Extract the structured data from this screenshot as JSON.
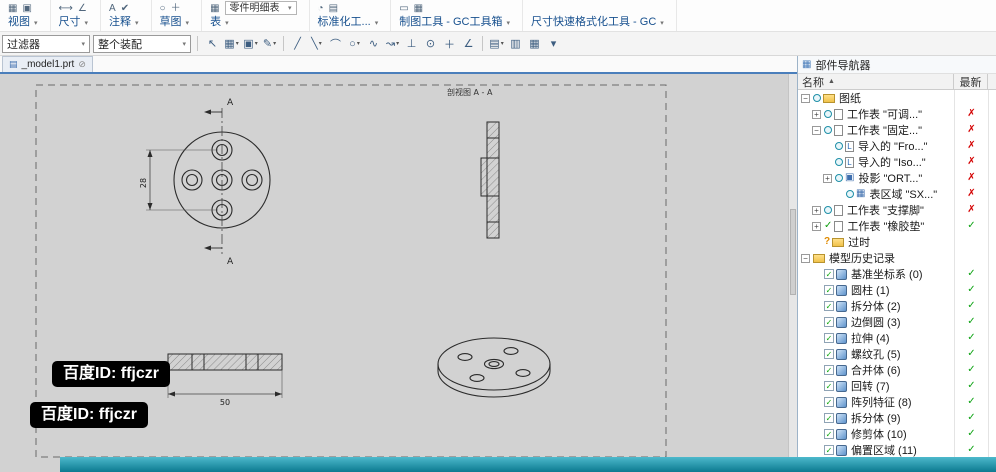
{
  "colors": {
    "accent_blue": "#4a7ebb",
    "status_red": "#d40000",
    "status_green": "#0da313",
    "canvas_bg": "#d2d2d2",
    "bottom_bar_top": "#4db9cc",
    "bottom_bar_bottom": "#0c7a90"
  },
  "ribbon": {
    "groups": [
      {
        "label": "视图",
        "icons": [
          "▦",
          "▣"
        ]
      },
      {
        "label": "尺寸",
        "icons": [
          "⟷",
          "∠"
        ]
      },
      {
        "label": "注释",
        "icons": [
          "A",
          "✔"
        ]
      },
      {
        "label": "草图",
        "icons": [
          "○",
          "＋"
        ]
      },
      {
        "label": "表",
        "icons": [
          "▦"
        ],
        "combo": "零件明细表"
      },
      {
        "label": "标准化工...",
        "icons": [
          "◔",
          "▤"
        ]
      },
      {
        "label": "制图工具 - GC工具箱",
        "icons": [
          "▭",
          "▦"
        ]
      },
      {
        "label": "尺寸快速格式化工具 - GC",
        "icons": []
      }
    ]
  },
  "toolbar": {
    "filter_label": "过滤器",
    "assembly_label": "整个装配",
    "icons": [
      {
        "g": "↖",
        "name": "select-cursor"
      },
      {
        "g": "▦",
        "dd": true,
        "name": "snap-grid"
      },
      {
        "g": "▣",
        "dd": true,
        "name": "display-style"
      },
      {
        "g": "✎",
        "dd": true,
        "name": "edit-sketch"
      },
      {
        "g": "sep"
      },
      {
        "g": "╱",
        "name": "line-tool"
      },
      {
        "g": "╲",
        "dd": true,
        "name": "profile-tool"
      },
      {
        "g": "⌒",
        "name": "arc-tool"
      },
      {
        "g": "○",
        "dd": true,
        "name": "circle-tool"
      },
      {
        "g": "∿",
        "name": "spline-tool"
      },
      {
        "g": "↝",
        "dd": true,
        "name": "studio-spline-tool"
      },
      {
        "g": "⊥",
        "name": "perpendicular-tool"
      },
      {
        "g": "⊙",
        "name": "point-tool"
      },
      {
        "g": "＋",
        "name": "plus-tool"
      },
      {
        "g": "∠",
        "name": "angle-tool"
      },
      {
        "g": "sep"
      },
      {
        "g": "▤",
        "dd": true,
        "name": "sheet-layout"
      },
      {
        "g": "▥",
        "name": "view-window"
      },
      {
        "g": "▦",
        "name": "grid-display"
      },
      {
        "g": "▾",
        "name": "more-options"
      }
    ]
  },
  "tab": {
    "label": "_model1.prt"
  },
  "canvas": {
    "section_view_label": "剖视图 A - A",
    "section_letter": "A",
    "dim_vertical": "28",
    "dim_horizontal": "50",
    "watermark": "百度ID: ffjczr"
  },
  "navigator": {
    "title": "部件导航器",
    "columns": [
      "名称",
      "最新"
    ],
    "rows": [
      {
        "indent": 0,
        "expand": "-",
        "marks": [
          "clock",
          "folder"
        ],
        "label": "图纸",
        "status": ""
      },
      {
        "indent": 1,
        "expand": "+",
        "marks": [
          "clock",
          "sheet"
        ],
        "label": "工作表 \"可调...\"",
        "status": "x"
      },
      {
        "indent": 1,
        "expand": "-",
        "marks": [
          "clock",
          "sheet"
        ],
        "label": "工作表 \"固定...\"",
        "status": "x"
      },
      {
        "indent": 2,
        "expand": "",
        "marks": [
          "clock",
          "import"
        ],
        "label": "导入的 \"Fro...\"",
        "status": "x"
      },
      {
        "indent": 2,
        "expand": "",
        "marks": [
          "clock",
          "import"
        ],
        "label": "导入的 \"Iso...\"",
        "status": "x"
      },
      {
        "indent": 2,
        "expand": "+",
        "marks": [
          "clock",
          "proj"
        ],
        "label": "投影 \"ORT...\"",
        "status": "x"
      },
      {
        "indent": 3,
        "expand": "",
        "marks": [
          "clock",
          "table"
        ],
        "label": "表区域 \"SX...\"",
        "status": "x"
      },
      {
        "indent": 1,
        "expand": "+",
        "marks": [
          "clock",
          "sheet"
        ],
        "label": "工作表 \"支撑脚\"",
        "status": "x"
      },
      {
        "indent": 1,
        "expand": "+",
        "marks": [
          "check",
          "sheet"
        ],
        "label": "工作表 \"橡胶垫\"",
        "status": "check"
      },
      {
        "indent": 1,
        "expand": "",
        "marks": [
          "question",
          "folder"
        ],
        "label": "过时",
        "status": ""
      },
      {
        "indent": 0,
        "expand": "-",
        "marks": [
          "folder"
        ],
        "label": "模型历史记录",
        "status": ""
      },
      {
        "indent": 1,
        "expand": "",
        "marks": [
          "checkbox",
          "feat"
        ],
        "label": "基准坐标系 (0)",
        "status": "check"
      },
      {
        "indent": 1,
        "expand": "",
        "marks": [
          "checkbox",
          "feat"
        ],
        "label": "圆柱 (1)",
        "status": "check"
      },
      {
        "indent": 1,
        "expand": "",
        "marks": [
          "checkbox",
          "feat"
        ],
        "label": "拆分体 (2)",
        "status": "check"
      },
      {
        "indent": 1,
        "expand": "",
        "marks": [
          "checkbox",
          "feat"
        ],
        "label": "边倒圆 (3)",
        "status": "check"
      },
      {
        "indent": 1,
        "expand": "",
        "marks": [
          "checkbox",
          "feat"
        ],
        "label": "拉伸 (4)",
        "status": "check"
      },
      {
        "indent": 1,
        "expand": "",
        "marks": [
          "checkbox",
          "feat"
        ],
        "label": "螺纹孔 (5)",
        "status": "check"
      },
      {
        "indent": 1,
        "expand": "",
        "marks": [
          "checkbox",
          "feat"
        ],
        "label": "合并体 (6)",
        "status": "check"
      },
      {
        "indent": 1,
        "expand": "",
        "marks": [
          "checkbox",
          "feat"
        ],
        "label": "回转 (7)",
        "status": "check"
      },
      {
        "indent": 1,
        "expand": "",
        "marks": [
          "checkbox",
          "feat"
        ],
        "label": "阵列特征 (8)",
        "status": "check"
      },
      {
        "indent": 1,
        "expand": "",
        "marks": [
          "checkbox",
          "feat"
        ],
        "label": "拆分体 (9)",
        "status": "check"
      },
      {
        "indent": 1,
        "expand": "",
        "marks": [
          "checkbox",
          "feat"
        ],
        "label": "修剪体 (10)",
        "status": "check"
      },
      {
        "indent": 1,
        "expand": "",
        "marks": [
          "checkbox",
          "feat"
        ],
        "label": "偏置区域 (11)",
        "status": "check"
      }
    ]
  }
}
